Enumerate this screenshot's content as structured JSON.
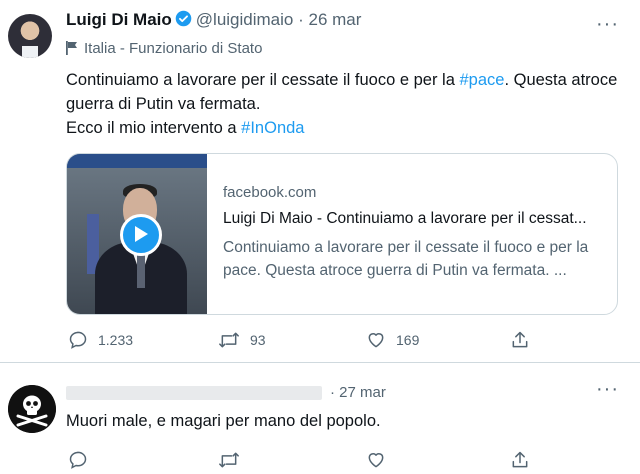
{
  "tweet": {
    "author_name": "Luigi Di Maio",
    "handle": "@luigidimaio",
    "separator": "·",
    "date": "26 mar",
    "label": "Italia - Funzionario di Stato",
    "text_part1": "Continuiamo a lavorare per il cessate il fuoco e per la ",
    "hashtag1": "#pace",
    "text_part2": ". Questa atroce guerra di Putin va fermata.",
    "text_part3": "Ecco il mio intervento a ",
    "hashtag2": "#InOnda",
    "card": {
      "domain": "facebook.com",
      "title": "Luigi Di Maio - Continuiamo a lavorare per il cessat...",
      "description": "Continuiamo a lavorare per il cessate il fuoco e per la pace. Questa atroce guerra di Putin va fermata. ..."
    },
    "actions": {
      "replies": "1.233",
      "retweets": "93",
      "likes": "169"
    }
  },
  "reply": {
    "date": "27 mar",
    "separator": "·",
    "text": "Muori male, e magari per mano del popolo."
  },
  "icons": {
    "more": "more-icon",
    "verified": "verified-badge-icon",
    "label": "government-flag-icon",
    "reply": "reply-icon",
    "retweet": "retweet-icon",
    "like": "like-icon",
    "share": "share-icon",
    "play": "play-icon",
    "reply_avatar": "skull-crossbones-icon"
  },
  "colors": {
    "accent": "#1d9bf0",
    "text": "#0f1419",
    "muted": "#536471",
    "border": "#cfd9de"
  },
  "more_glyph": "···"
}
